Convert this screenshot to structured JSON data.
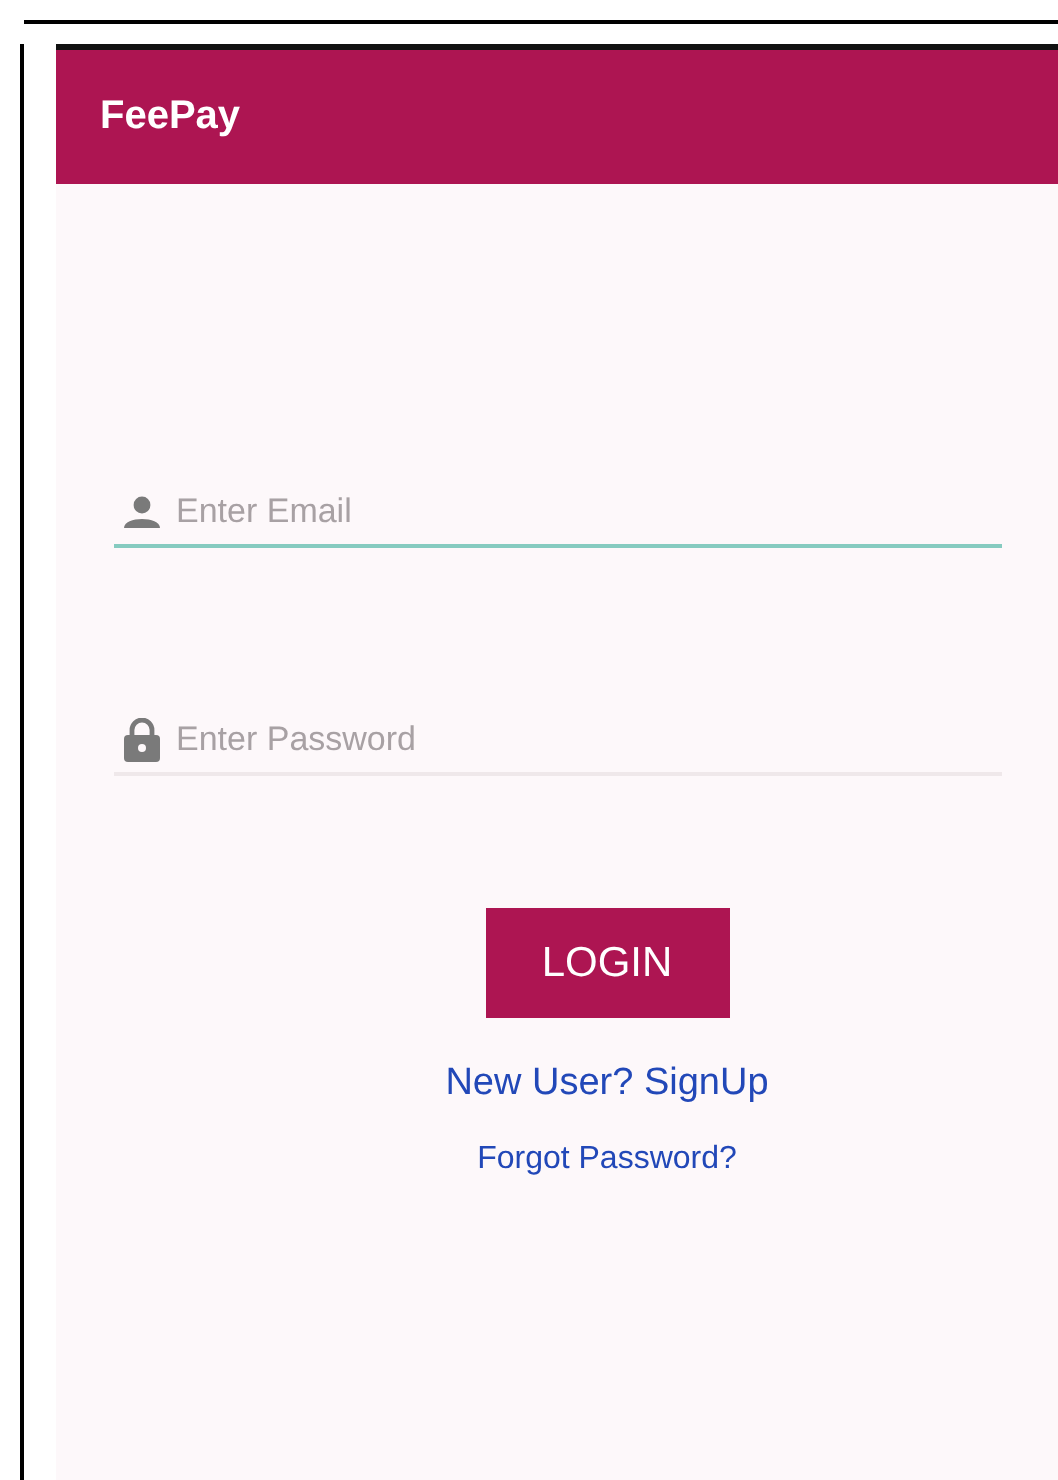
{
  "app_bar": {
    "title": "FeePay"
  },
  "fields": [
    {
      "kind": "email",
      "placeholder": "Enter Email",
      "focused": true
    },
    {
      "kind": "password",
      "placeholder": "Enter Password",
      "focused": false
    }
  ],
  "login_button": {
    "label": "LOGIN"
  },
  "links": [
    {
      "kind": "primary",
      "label": "New User? SignUp"
    },
    {
      "kind": "secondary",
      "label": "Forgot Password?"
    }
  ]
}
